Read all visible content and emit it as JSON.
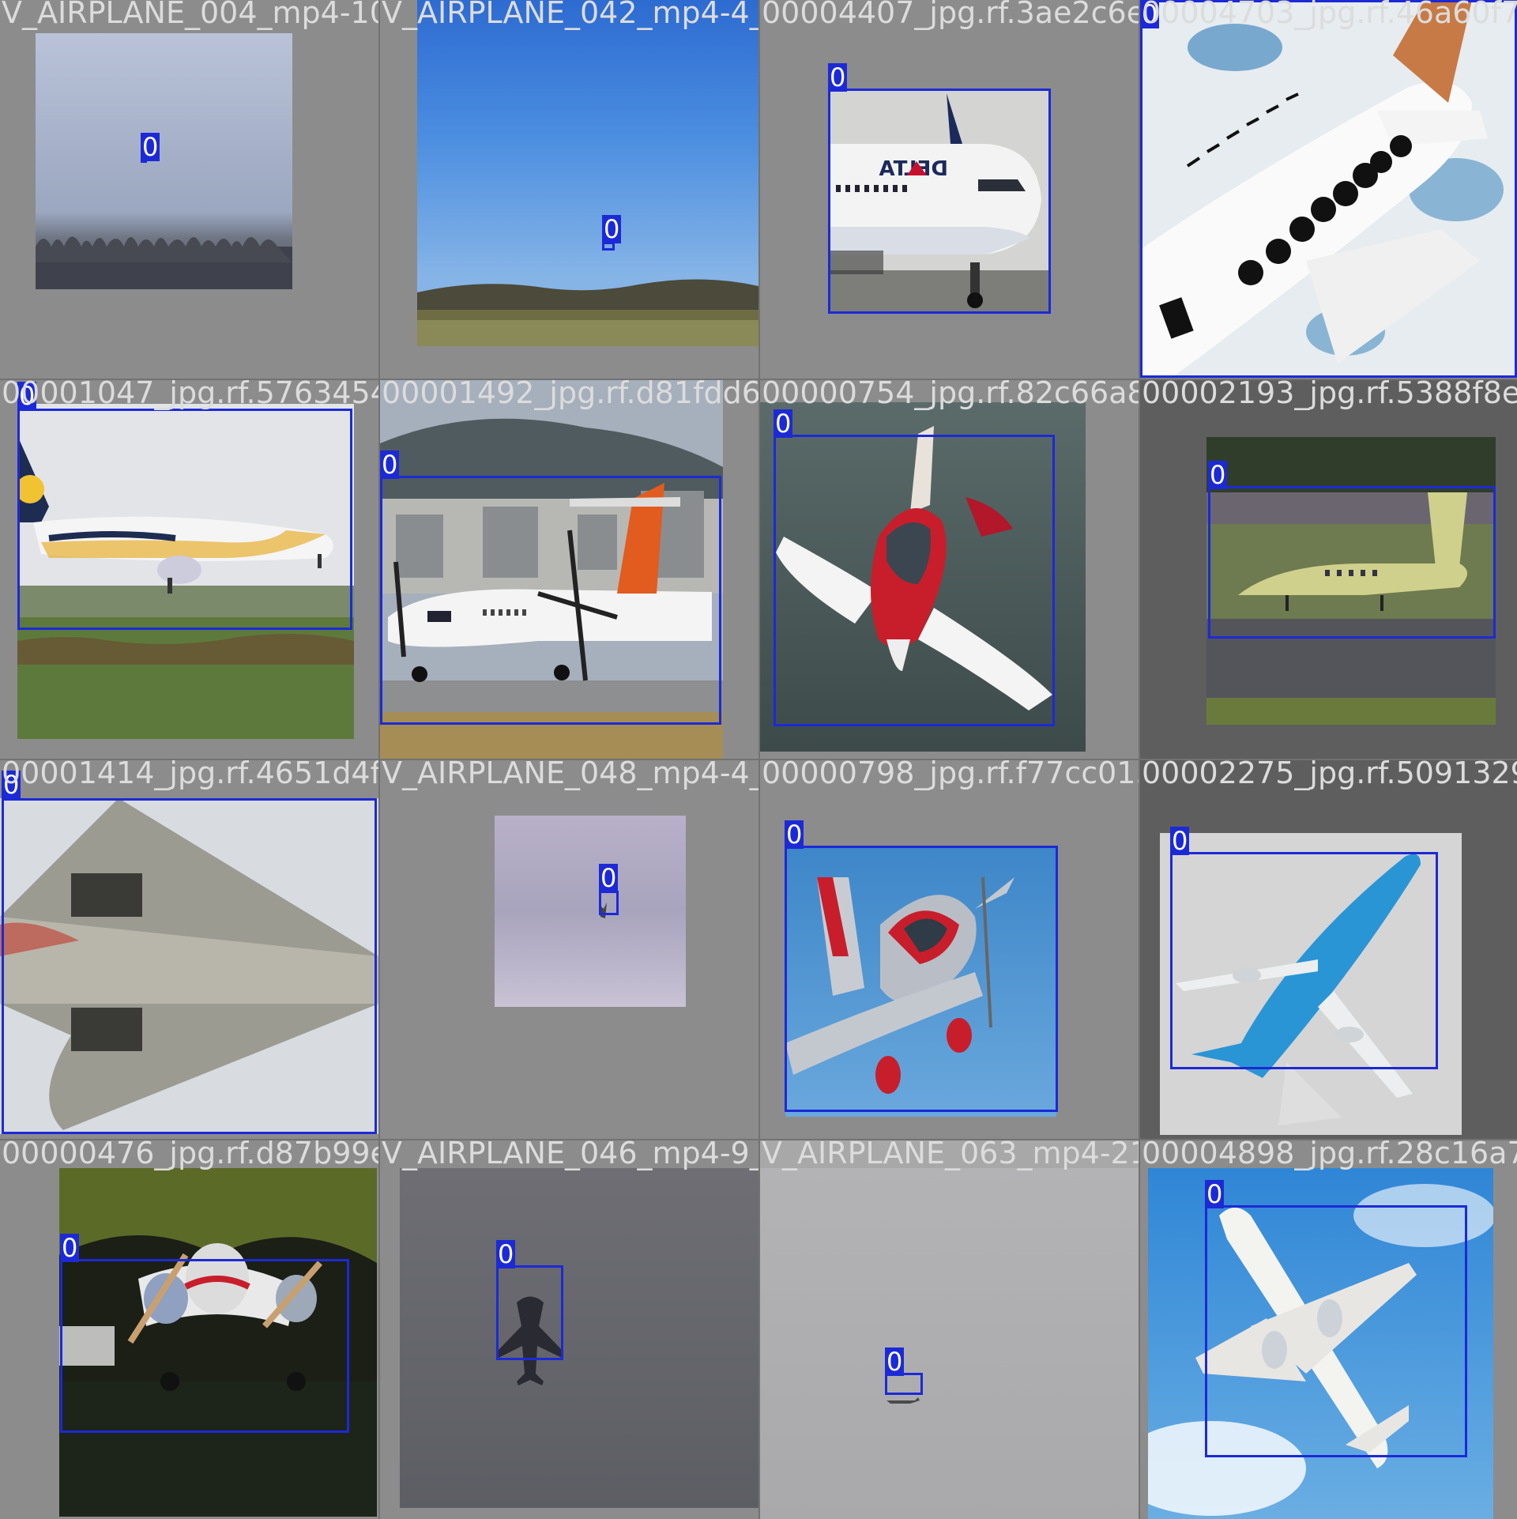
{
  "mosaic": {
    "tiles": [
      {
        "file": "V_AIRPLANE_004_mp4-10_jpg.rf.52d3e42660",
        "label": "0"
      },
      {
        "file": "V_AIRPLANE_042_mp4-4_jpg.rf.2440cf3aef24",
        "label": "0"
      },
      {
        "file": "00004407_jpg.rf.3ae2c6eb2c0b0",
        "label": "0"
      },
      {
        "file": "00004703_jpg.rf.46a60f7cf2e6",
        "label": "0"
      },
      {
        "file": "00001047_jpg.rf.5763454e97",
        "label": "0"
      },
      {
        "file": "00001492_jpg.rf.d81fdd61a5f",
        "label": "0"
      },
      {
        "file": "00000754_jpg.rf.82c66a8bd10",
        "label": "0"
      },
      {
        "file": "00002193_jpg.rf.5388f8e403b",
        "label": "0"
      },
      {
        "file": "00001414_jpg.rf.4651d4f073",
        "label": "0"
      },
      {
        "file": "V_AIRPLANE_048_mp4-4_jpg.rf.d3e7",
        "label": "0"
      },
      {
        "file": "00000798_jpg.rf.f77cc015e",
        "label": "0"
      },
      {
        "file": "00002275_jpg.rf.50913298155",
        "label": "0"
      },
      {
        "file": "00000476_jpg.rf.d87b99e66f",
        "label": "0"
      },
      {
        "file": "V_AIRPLANE_046_mp4-9_jpg.rf.6fe1e37a",
        "label": "0"
      },
      {
        "file": "V_AIRPLANE_063_mp4-21_jpg.rf.d9f6edecc",
        "label": "0"
      },
      {
        "file": "00004898_jpg.rf.28c16a7c698",
        "label": "0"
      }
    ],
    "colors": {
      "box": "#1c2ad6",
      "padding": "#8c8c8c",
      "label_text": "#ffffff"
    }
  }
}
